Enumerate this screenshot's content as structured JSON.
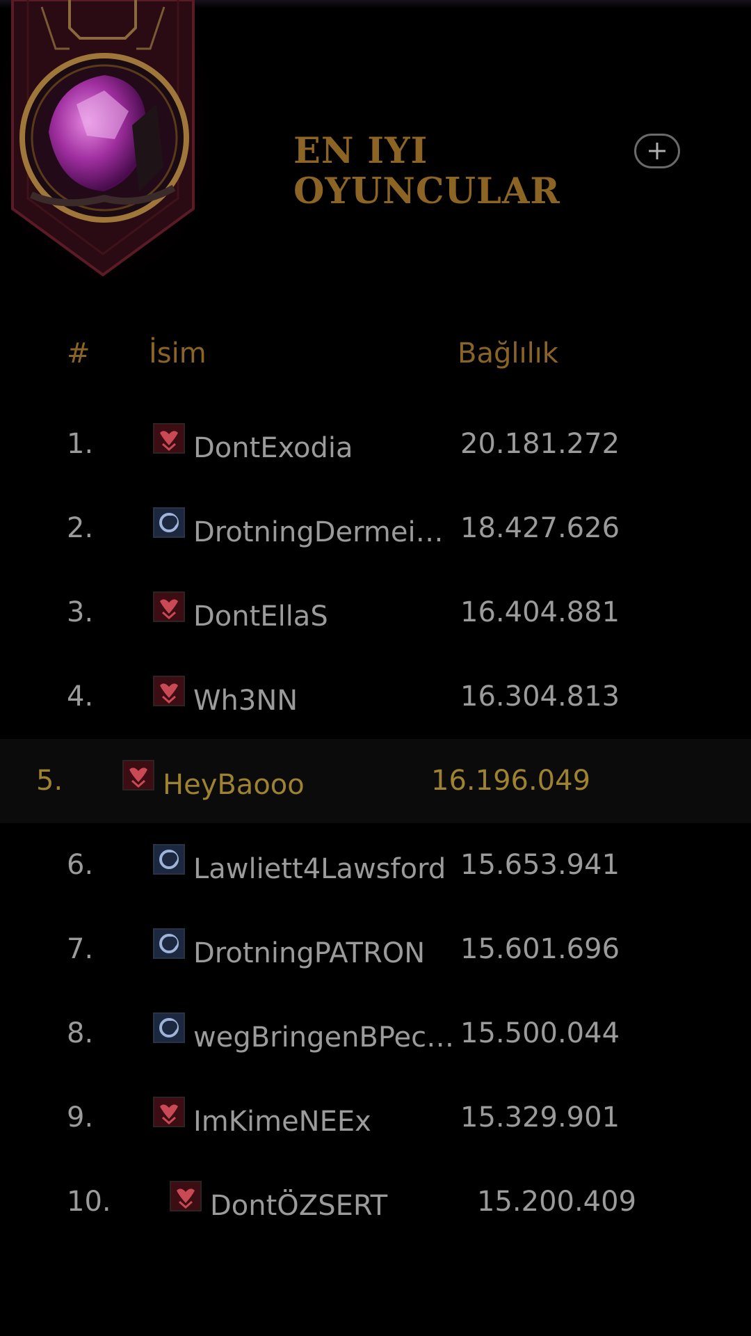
{
  "header": {
    "title_line1": "EN IYI",
    "title_line2": "OYUNCULAR"
  },
  "icons": {
    "banner": "faction-crest-banner",
    "add": "plus-icon",
    "faction_red": "red-faction-icon",
    "faction_blue": "blue-faction-icon"
  },
  "colors": {
    "accent_gold": "#8c6424",
    "highlight_text": "#9c8231",
    "row_text": "#9b9b9b",
    "background": "#000000"
  },
  "table": {
    "columns": [
      "#",
      "İsim",
      "Bağlılık"
    ],
    "rows": [
      {
        "rank": "1.",
        "name": "DontExodia",
        "score": "20.181.272",
        "faction": "red"
      },
      {
        "rank": "2.",
        "name": "DrotningDermeist...",
        "score": "18.427.626",
        "faction": "blue"
      },
      {
        "rank": "3.",
        "name": "DontEllaS",
        "score": "16.404.881",
        "faction": "red"
      },
      {
        "rank": "4.",
        "name": "Wh3NN",
        "score": "16.304.813",
        "faction": "red"
      },
      {
        "rank": "5.",
        "name": "HeyBaooo",
        "score": "16.196.049",
        "faction": "red",
        "current_player": true
      },
      {
        "rank": "6.",
        "name": "Lawliett4Lawsford",
        "score": "15.653.941",
        "faction": "blue"
      },
      {
        "rank": "7.",
        "name": "DrotningPATRON",
        "score": "15.601.696",
        "faction": "blue"
      },
      {
        "rank": "8.",
        "name": "wegBringenBPeces",
        "score": "15.500.044",
        "faction": "blue"
      },
      {
        "rank": "9.",
        "name": "ImKimeNEEx",
        "score": "15.329.901",
        "faction": "red"
      },
      {
        "rank": "10.",
        "name": "DontÖZSERT",
        "score": "15.200.409",
        "faction": "red"
      }
    ]
  }
}
